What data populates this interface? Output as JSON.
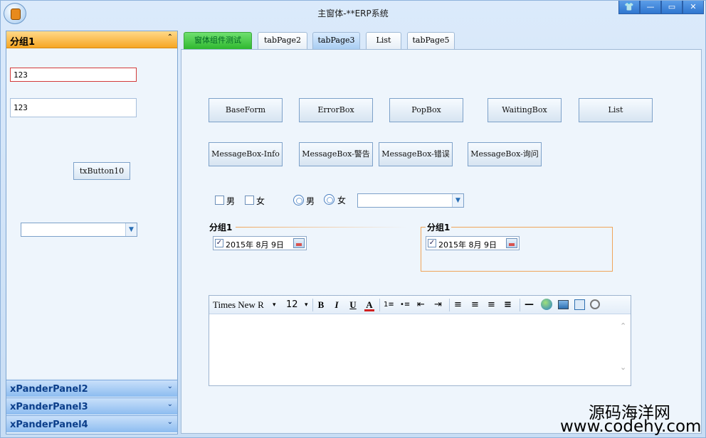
{
  "window": {
    "title": "主窗体-**ERP系统",
    "controls": {
      "skin": "👕",
      "minimize": "—",
      "maximize": "▭",
      "close": "✕"
    }
  },
  "left_panel": {
    "group_title": "分组1",
    "collapse_icon": "⌃",
    "input1_value": "123",
    "input2_value": "123",
    "button_label": "txButton10",
    "combo_value": "",
    "expander_panels": [
      {
        "label": "xPanderPanel2",
        "icon": "⌄"
      },
      {
        "label": "xPanderPanel3",
        "icon": "⌄"
      },
      {
        "label": "xPanderPanel4",
        "icon": "⌄"
      }
    ]
  },
  "tabs": [
    {
      "label": "窗体组件测试"
    },
    {
      "label": "tabPage2"
    },
    {
      "label": "tabPage3"
    },
    {
      "label": "List"
    },
    {
      "label": "tabPage5"
    }
  ],
  "main": {
    "row1_buttons": [
      "BaseForm",
      "ErrorBox",
      "PopBox",
      "WaitingBox",
      "List"
    ],
    "row2_buttons": [
      "MessageBox-Info",
      "MessageBox-警告",
      "MessageBox-错误",
      "MessageBox-询问"
    ],
    "checkbox_male": "男",
    "checkbox_female": "女",
    "radio_male": "男",
    "radio_female": "女",
    "combo_value": "",
    "group1": {
      "title": "分组1",
      "date": "2015年  8月  9日"
    },
    "group2": {
      "title": "分组1",
      "date": "2015年  8月  9日"
    },
    "editor": {
      "font_name": "Times New R",
      "font_size": "12",
      "tools": {
        "bold": "B",
        "italic": "I",
        "underline": "U",
        "color": "A",
        "numbered": "1≡",
        "bullets": "•≡",
        "outdent": "⇤",
        "indent": "⇥",
        "align_left": "≡",
        "align_center": "≡",
        "align_right": "≡",
        "justify": "≡",
        "hr": "—"
      }
    }
  },
  "watermark": {
    "line1": "源码海洋网",
    "line2": "www.codehy.com"
  }
}
